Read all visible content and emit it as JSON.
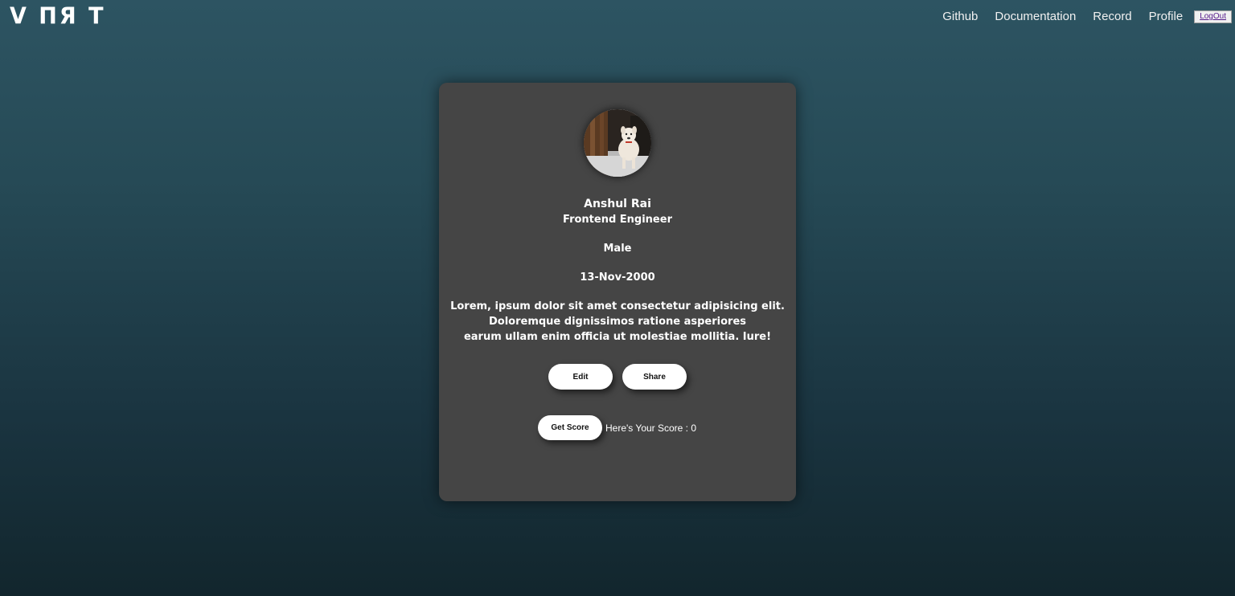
{
  "header": {
    "logo_text": "V ПЯ T",
    "nav": {
      "github": "Github",
      "documentation": "Documentation",
      "record": "Record",
      "profile": "Profile",
      "logout": "LogOut"
    }
  },
  "profile": {
    "name": "Anshul Rai",
    "title": "Frontend Engineer",
    "gender": "Male",
    "dob": "13-Nov-2000",
    "bio_lines": [
      "Lorem, ipsum dolor sit amet consectetur adipisicing elit.",
      "Doloremque dignissimos ratione asperiores",
      "earum ullam enim officia ut molestiae mollitia. Iure!"
    ],
    "edit_label": "Edit",
    "share_label": "Share",
    "get_score_label": "Get Score",
    "score_text": "Here's Your Score : 0"
  },
  "colors": {
    "card_bg": "#454545",
    "page_top": "#2d5462",
    "page_bottom": "#12262d"
  },
  "icons": {
    "avatar": "dog-photo"
  }
}
